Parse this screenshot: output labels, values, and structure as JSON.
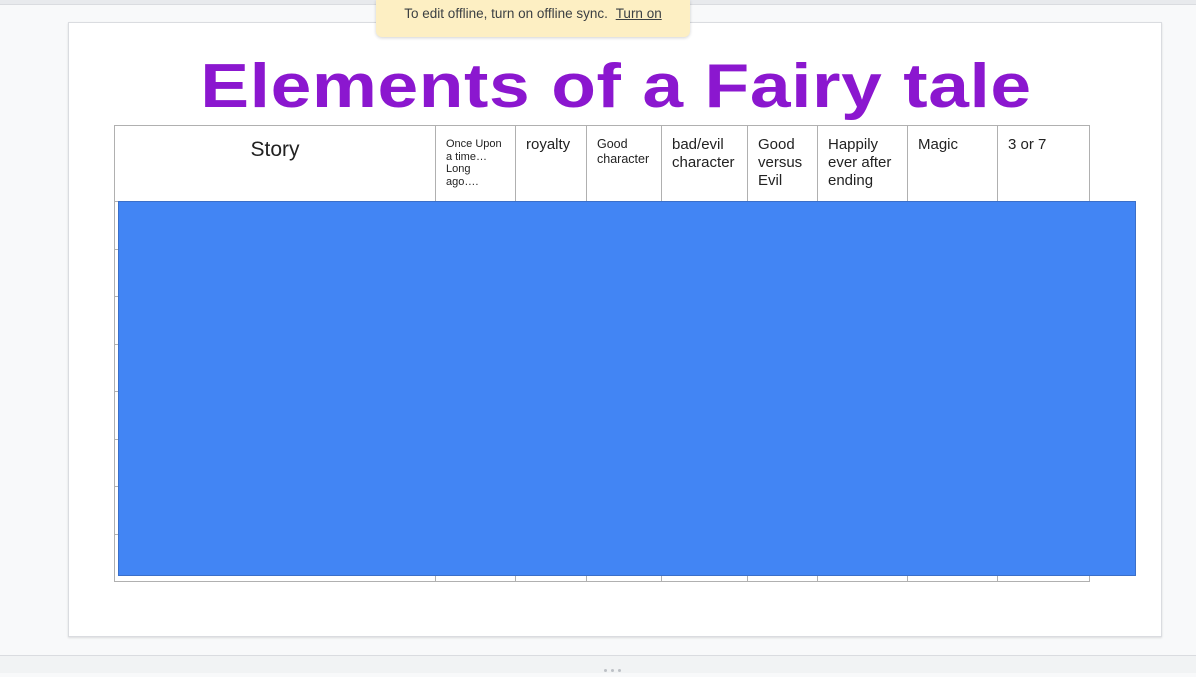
{
  "notification": {
    "message": "To edit offline, turn on offline sync.",
    "action_label": "Turn on"
  },
  "slide": {
    "title": "Elements of a Fairy tale",
    "title_color": "#8b17cf",
    "table": {
      "headers": [
        "Story",
        "Once Upon a time… Long ago….",
        "royalty",
        "Good character",
        "bad/evil character",
        "Good versus Evil",
        "Happily ever after ending",
        "Magic",
        "3 or 7"
      ],
      "body_row_count": 8
    },
    "shape": {
      "type": "rectangle",
      "fill_color": "#4285f4"
    }
  }
}
